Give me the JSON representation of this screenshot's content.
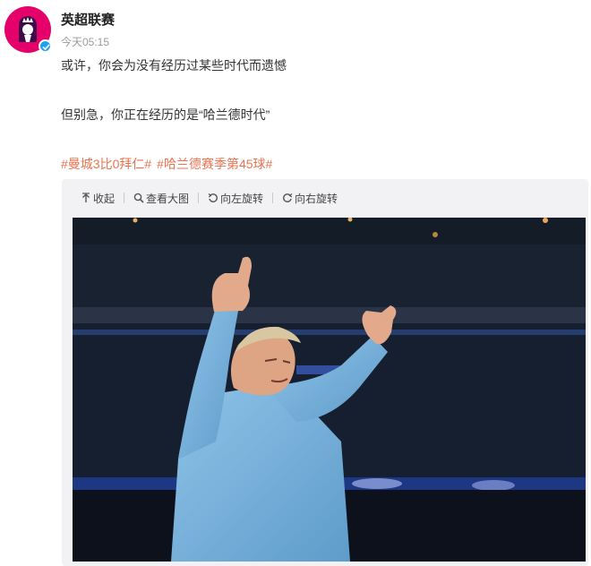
{
  "account": {
    "name": "英超联赛",
    "time": "今天05:15"
  },
  "post": {
    "line1": "或许，你会为没有经历过某些时代而遗憾",
    "line2": "但别急，你正在经历的是“哈兰德时代”",
    "hashtags": [
      "#曼城3比0拜仁#",
      "#哈兰德赛季第45球#"
    ]
  },
  "media_toolbar": {
    "collapse": "收起",
    "view_large": "查看大图",
    "rotate_left": "向左旋转",
    "rotate_right": "向右旋转"
  },
  "colors": {
    "hashtag": "#eb7350",
    "avatar_bg": "#e5006a",
    "verified": "#1da1f2"
  },
  "icons": [
    "premier-league-lion-icon",
    "verified-icon",
    "collapse-icon",
    "search-icon",
    "rotate-left-icon",
    "rotate-right-icon"
  ]
}
